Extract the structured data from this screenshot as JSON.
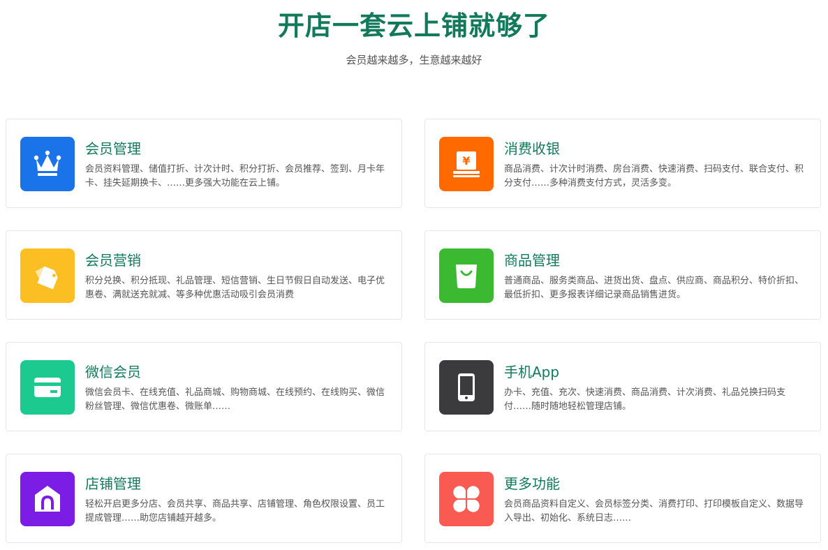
{
  "theme": {
    "title_color": "#127a5a",
    "card_title_color": "#127a5a"
  },
  "hero": {
    "title": "开店一套云上铺就够了",
    "subtitle": "会员越来越多，生意越来越好"
  },
  "features": [
    {
      "title": "会员管理",
      "desc": "会员资料管理、储值打折、计次计时、积分打折、会员推荐、签到、月卡年卡、挂失延期换卡、……更多强大功能在云上铺。",
      "icon": "crown-icon",
      "color": "#1a73e8"
    },
    {
      "title": "消费收银",
      "desc": "商品消费、计次计时消费、房台消费、快速消费、扫码支付、联合支付、积分支付……多种消费支付方式，灵活多变。",
      "icon": "cash-register-icon",
      "color": "#ff6a00"
    },
    {
      "title": "会员营销",
      "desc": "积分兑换、积分抵现、礼品管理、短信营销、生日节假日自动发送、电子优惠卷、满就送充就减、等多种优惠活动吸引会员消费",
      "icon": "tags-icon",
      "color": "#fbbf24"
    },
    {
      "title": "商品管理",
      "desc": "普通商品、服务类商品、进货出货、盘点、供应商、商品积分、特价折扣、最低折扣、更多报表详细记录商品销售进货。",
      "icon": "shopping-bag-icon",
      "color": "#3bb931"
    },
    {
      "title": "微信会员",
      "desc": "微信会员卡、在线充值、礼品商城、购物商城、在线预约、在线购买、微信粉丝管理、微信优惠卷、微账单……",
      "icon": "card-icon",
      "color": "#1cc98e"
    },
    {
      "title": "手机App",
      "desc": "办卡、充值、充次、快速消费、商品消费、计次消费、礼品兑换扫码支付……随时随地轻松管理店铺。",
      "icon": "mobile-phone-icon",
      "color": "#3b3b3d"
    },
    {
      "title": "店铺管理",
      "desc": "轻松开启更多分店、会员共享、商品共享、店铺管理、角色权限设置、员工提成管理……助您店铺越开越多。",
      "icon": "store-icon",
      "color": "#7c1de6"
    },
    {
      "title": "更多功能",
      "desc": "会员商品资料自定义、会员标签分类、消费打印、打印模板自定义、数据导入导出、初始化、系统日志……",
      "icon": "grid-icon",
      "color": "#f95a52"
    }
  ]
}
